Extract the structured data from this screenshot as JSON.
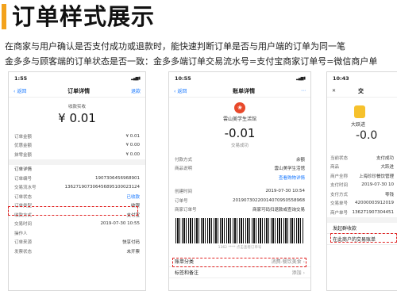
{
  "page": {
    "title": "订单样式展示",
    "desc1": "在商家与用户确认是否支付成功或退款时，能快速判断订单是否与用户端的订单为同一笔",
    "desc2": "金多多与顾客端的订单状态是否一致：金多多端订单交易流水号=支付宝商家订单号=微信商户单"
  },
  "phone1": {
    "time": "1:55",
    "back": "返回",
    "nav_title": "订单详情",
    "nav_right": "退款",
    "label": "收款实收",
    "amount": "¥ 0.01",
    "rows_a": [
      {
        "k": "订单金额",
        "v": "¥ 0.01"
      },
      {
        "k": "优惠金额",
        "v": "¥ 0.00"
      },
      {
        "k": "抹零金额",
        "v": "¥ 0.00"
      }
    ],
    "section": "订单详情",
    "rows_b": [
      {
        "k": "订单编号",
        "v": "1907306456968901"
      },
      {
        "k": "交易流水号",
        "v": "136271907306456895100023124"
      },
      {
        "k": "订单状态",
        "v": "已收款"
      },
      {
        "k": "订单类型",
        "v": "收银"
      },
      {
        "k": "收款方式",
        "v": "支付宝"
      },
      {
        "k": "交易时间",
        "v": "2019-07-30 10:55"
      },
      {
        "k": "操作人",
        "v": ""
      },
      {
        "k": "订单来源",
        "v": "快享付码"
      },
      {
        "k": "发票状态",
        "v": "未开票"
      }
    ]
  },
  "phone2": {
    "time": "10:55",
    "back": "返回",
    "nav_title": "账单详情",
    "merchant": "雲山美学生活馆",
    "amount": "-0.01",
    "status": "交易成功",
    "rows_a": [
      {
        "k": "付款方式",
        "v": "余额"
      },
      {
        "k": "商品说明",
        "v": "雲山美学生活馆"
      },
      {
        "k": "",
        "v": "查看购物详情"
      }
    ],
    "rows_b": [
      {
        "k": "创建时间",
        "v": "2019-07-30 10:54"
      },
      {
        "k": "订单号",
        "v": "20190730220014070950558968"
      },
      {
        "k": "商家订单号",
        "v": "商家可码扫退款或查询交易"
      }
    ],
    "barcode_num": "1362 **** 点击查看订单号",
    "footer": [
      {
        "k": "账单分类",
        "v": "消费-餐饮美食"
      },
      {
        "k": "标签和备注",
        "v": "添加"
      }
    ]
  },
  "phone3": {
    "time": "10:43",
    "nav_title": "交",
    "merchant": "大跃进",
    "amount": "-0.0",
    "rows": [
      {
        "k": "当前状态",
        "v": "支付成功"
      },
      {
        "k": "商品",
        "v": "大跃进"
      },
      {
        "k": "商户全称",
        "v": "上海珍珍餐饮管理"
      },
      {
        "k": "支付时间",
        "v": "2019-07-30 10"
      },
      {
        "k": "支付方式",
        "v": "零钱"
      },
      {
        "k": "交易单号",
        "v": "42000003912019"
      },
      {
        "k": "商户单号",
        "v": "136271907304451"
      }
    ],
    "footer": [
      {
        "k": "发起群收款"
      },
      {
        "k": "在此商户的交易账单"
      }
    ]
  },
  "colors": {
    "accent": "#f3a21c",
    "link": "#1677ff",
    "highlight": "#e02020"
  }
}
